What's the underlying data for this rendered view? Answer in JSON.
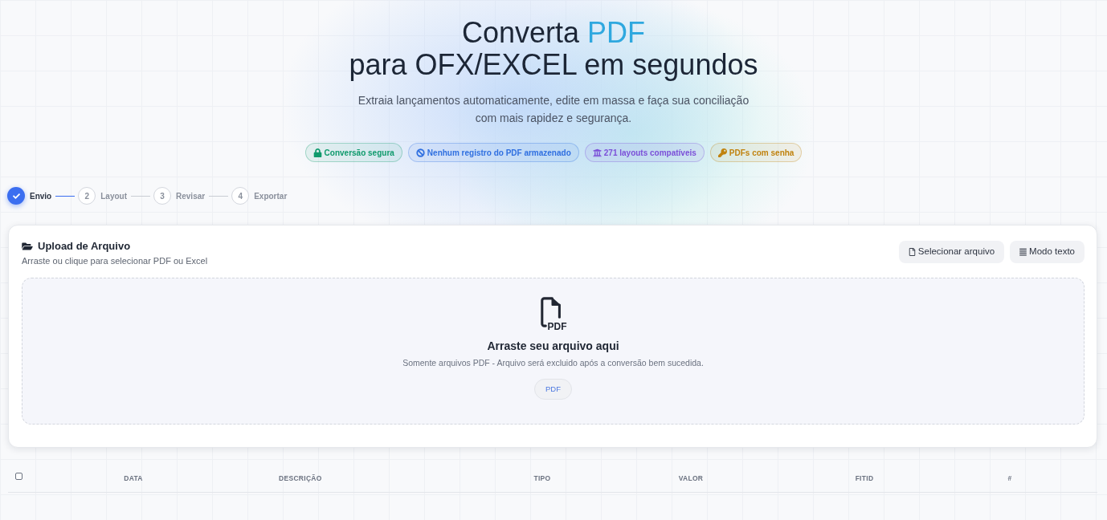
{
  "hero": {
    "title_start": "Converta",
    "title_highlight": "PDF",
    "title_end": "para OFX/EXCEL em segundos",
    "subtitle": "Extraia lançamentos automaticamente, edite em massa e faça sua conciliação com mais rapidez e segurança."
  },
  "badges": [
    {
      "kind": "lock",
      "label": "Conversão segura",
      "color": "#0f9a6c"
    },
    {
      "kind": "blocked",
      "label": "Nenhum registro do PDF armazenado",
      "color": "#2f6fe0"
    },
    {
      "kind": "bank",
      "label": "271 layouts compatíveis",
      "color": "#7b4fd8"
    },
    {
      "kind": "key",
      "label": "PDFs com senha",
      "color": "#c0820e"
    }
  ],
  "steps": [
    {
      "label": "Envio",
      "done": true
    },
    {
      "number": "2",
      "label": "Layout",
      "done": false
    },
    {
      "number": "3",
      "label": "Revisar",
      "done": false
    },
    {
      "number": "4",
      "label": "Exportar",
      "done": false
    }
  ],
  "upload": {
    "title": "Upload de Arquivo",
    "subtitle": "Arraste ou clique para selecionar PDF ou Excel",
    "buttons": [
      {
        "kind": "file",
        "label": "Selecionar arquivo"
      },
      {
        "kind": "list",
        "label": "Modo texto"
      }
    ],
    "dropzone": {
      "icon_label": "PDF",
      "title": "Arraste seu arquivo aqui",
      "subtitle": "Somente arquivos PDF - Arquivo será excluido após a conversão bem sucedida.",
      "format_tag": "PDF"
    }
  },
  "table": {
    "select_all": {
      "checked": false
    },
    "columns": [
      "DATA",
      "DESCRIÇÃO",
      "TIPO",
      "VALOR",
      "FITID",
      "#"
    ]
  }
}
